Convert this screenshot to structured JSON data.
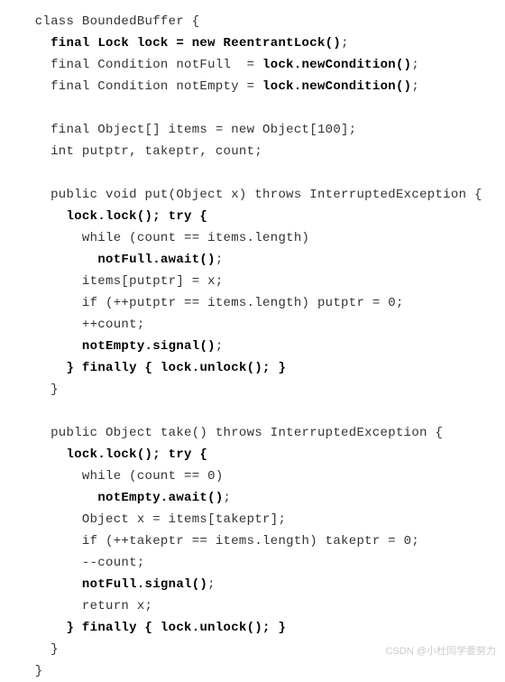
{
  "lines": [
    {
      "segments": [
        {
          "text": " class BoundedBuffer {",
          "bold": false
        }
      ]
    },
    {
      "segments": [
        {
          "text": "   ",
          "bold": false
        },
        {
          "text": "final Lock lock = new ReentrantLock()",
          "bold": true
        },
        {
          "text": ";",
          "bold": false
        }
      ]
    },
    {
      "segments": [
        {
          "text": "   final Condition notFull  = ",
          "bold": false
        },
        {
          "text": "lock.newCondition()",
          "bold": true
        },
        {
          "text": ";",
          "bold": false
        }
      ]
    },
    {
      "segments": [
        {
          "text": "   final Condition notEmpty = ",
          "bold": false
        },
        {
          "text": "lock.newCondition()",
          "bold": true
        },
        {
          "text": ";",
          "bold": false
        }
      ]
    },
    {
      "segments": [
        {
          "text": "",
          "bold": false
        }
      ]
    },
    {
      "segments": [
        {
          "text": "   final Object[] items = new Object[100];",
          "bold": false
        }
      ]
    },
    {
      "segments": [
        {
          "text": "   int putptr, takeptr, count;",
          "bold": false
        }
      ]
    },
    {
      "segments": [
        {
          "text": "",
          "bold": false
        }
      ]
    },
    {
      "segments": [
        {
          "text": "   public void put(Object x) throws InterruptedException {",
          "bold": false
        }
      ]
    },
    {
      "segments": [
        {
          "text": "     ",
          "bold": false
        },
        {
          "text": "lock.lock();",
          "bold": true
        },
        {
          "text": " ",
          "bold": false
        },
        {
          "text": "try {",
          "bold": true
        }
      ]
    },
    {
      "segments": [
        {
          "text": "       while (count == items.length)",
          "bold": false
        }
      ]
    },
    {
      "segments": [
        {
          "text": "         ",
          "bold": false
        },
        {
          "text": "notFull.await()",
          "bold": true
        },
        {
          "text": ";",
          "bold": false
        }
      ]
    },
    {
      "segments": [
        {
          "text": "       items[putptr] = x;",
          "bold": false
        }
      ]
    },
    {
      "segments": [
        {
          "text": "       if (++putptr == items.length) putptr = 0;",
          "bold": false
        }
      ]
    },
    {
      "segments": [
        {
          "text": "       ++count;",
          "bold": false
        }
      ]
    },
    {
      "segments": [
        {
          "text": "       ",
          "bold": false
        },
        {
          "text": "notEmpty.signal()",
          "bold": true
        },
        {
          "text": ";",
          "bold": false
        }
      ]
    },
    {
      "segments": [
        {
          "text": "     ",
          "bold": false
        },
        {
          "text": "} finally { lock.unlock(); }",
          "bold": true
        }
      ]
    },
    {
      "segments": [
        {
          "text": "   }",
          "bold": false
        }
      ]
    },
    {
      "segments": [
        {
          "text": "",
          "bold": false
        }
      ]
    },
    {
      "segments": [
        {
          "text": "   public Object take() throws InterruptedException {",
          "bold": false
        }
      ]
    },
    {
      "segments": [
        {
          "text": "     ",
          "bold": false
        },
        {
          "text": "lock.lock();",
          "bold": true
        },
        {
          "text": " ",
          "bold": false
        },
        {
          "text": "try {",
          "bold": true
        }
      ]
    },
    {
      "segments": [
        {
          "text": "       while (count == 0)",
          "bold": false
        }
      ]
    },
    {
      "segments": [
        {
          "text": "         ",
          "bold": false
        },
        {
          "text": "notEmpty.await()",
          "bold": true
        },
        {
          "text": ";",
          "bold": false
        }
      ]
    },
    {
      "segments": [
        {
          "text": "       Object x = items[takeptr];",
          "bold": false
        }
      ]
    },
    {
      "segments": [
        {
          "text": "       if (++takeptr == items.length) takeptr = 0;",
          "bold": false
        }
      ]
    },
    {
      "segments": [
        {
          "text": "       --count;",
          "bold": false
        }
      ]
    },
    {
      "segments": [
        {
          "text": "       ",
          "bold": false
        },
        {
          "text": "notFull.signal()",
          "bold": true
        },
        {
          "text": ";",
          "bold": false
        }
      ]
    },
    {
      "segments": [
        {
          "text": "       return x;",
          "bold": false
        }
      ]
    },
    {
      "segments": [
        {
          "text": "     ",
          "bold": false
        },
        {
          "text": "} finally { lock.unlock(); }",
          "bold": true
        }
      ]
    },
    {
      "segments": [
        {
          "text": "   }",
          "bold": false
        }
      ]
    },
    {
      "segments": [
        {
          "text": " }",
          "bold": false
        }
      ]
    }
  ],
  "watermark": "CSDN @小杜同学要努力"
}
